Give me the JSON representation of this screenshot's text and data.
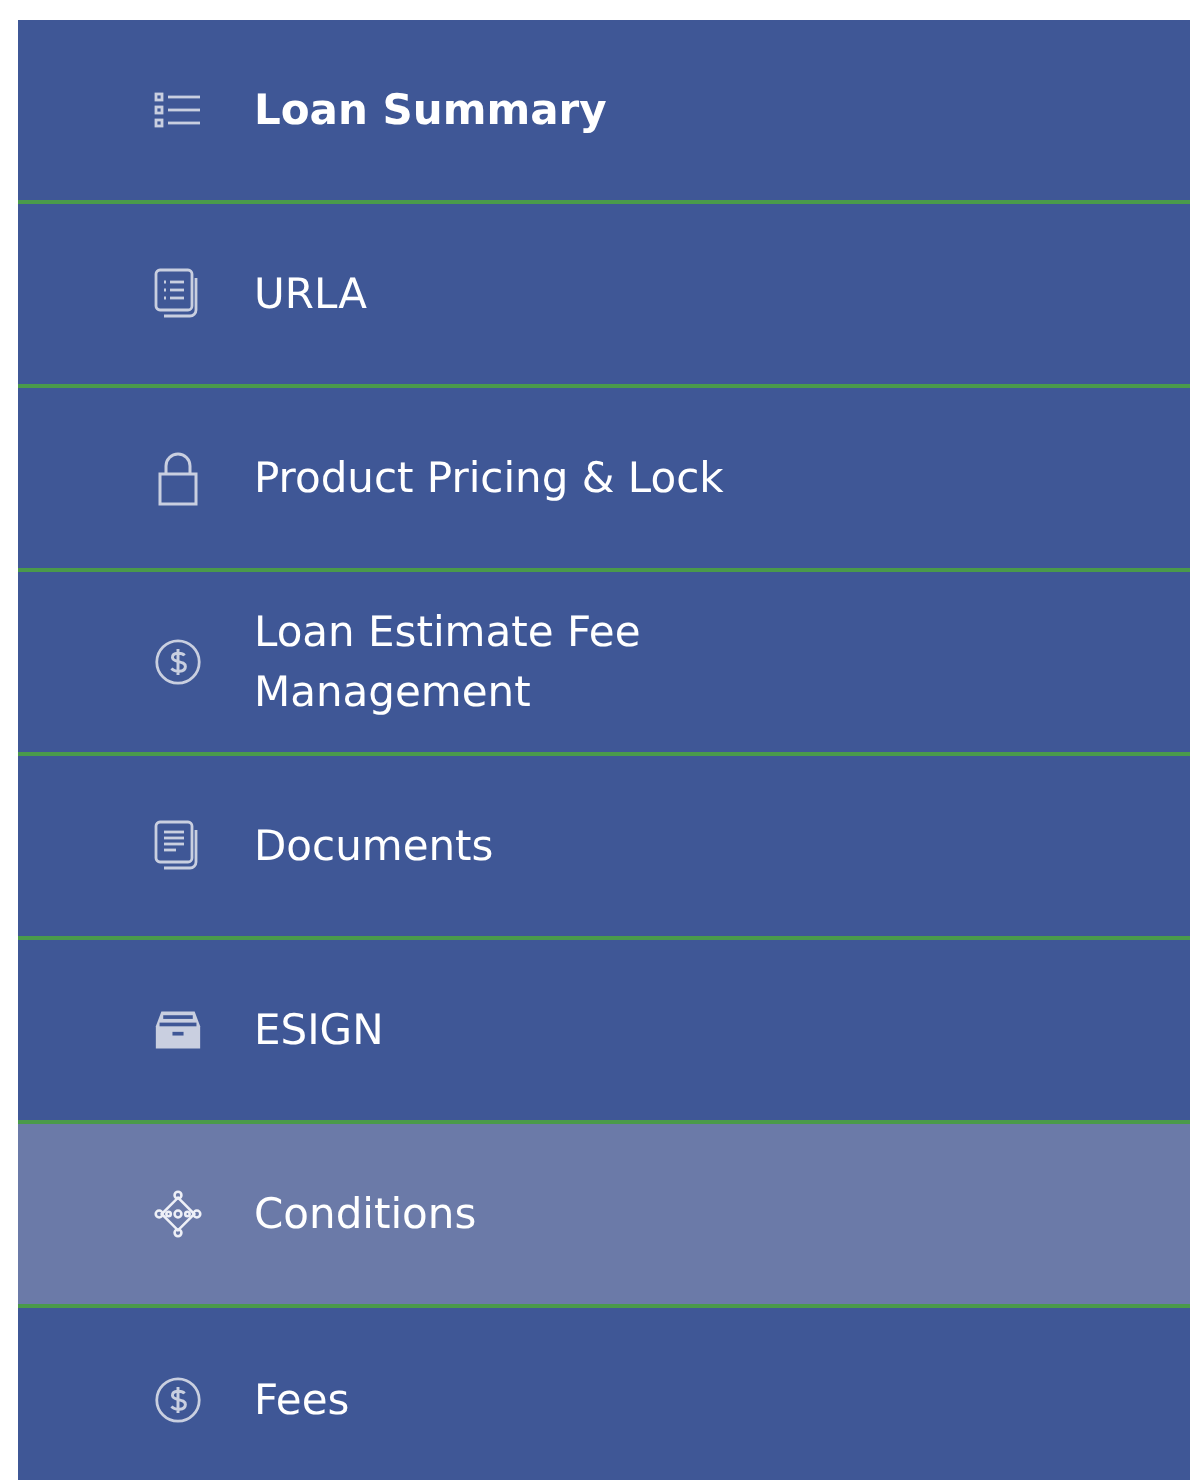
{
  "nav": {
    "items": [
      {
        "label": "Loan Summary",
        "kind": "list",
        "current": true,
        "selected": false
      },
      {
        "label": "URLA",
        "kind": "form",
        "current": false,
        "selected": false
      },
      {
        "label": "Product Pricing & Lock",
        "kind": "lock",
        "current": false,
        "selected": false
      },
      {
        "label": "Loan Estimate Fee Management",
        "kind": "dollar",
        "current": false,
        "selected": false
      },
      {
        "label": "Documents",
        "kind": "document",
        "current": false,
        "selected": false
      },
      {
        "label": "ESIGN",
        "kind": "tray",
        "current": false,
        "selected": false
      },
      {
        "label": "Conditions",
        "kind": "network",
        "current": false,
        "selected": true
      },
      {
        "label": "Fees",
        "kind": "dollar",
        "current": false,
        "selected": false
      }
    ]
  }
}
